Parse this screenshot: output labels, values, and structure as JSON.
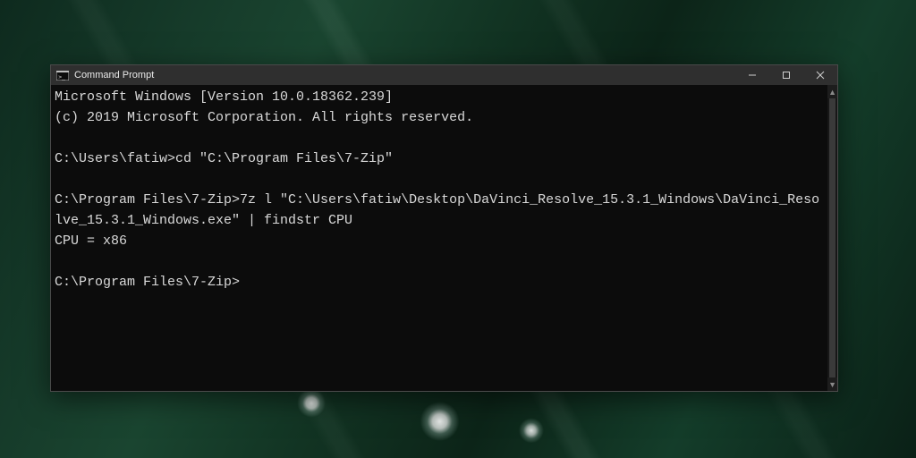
{
  "window": {
    "title": "Command Prompt"
  },
  "terminal": {
    "lines": [
      "Microsoft Windows [Version 10.0.18362.239]",
      "(c) 2019 Microsoft Corporation. All rights reserved.",
      "",
      "C:\\Users\\fatiw>cd \"C:\\Program Files\\7-Zip\"",
      "",
      "C:\\Program Files\\7-Zip>7z l \"C:\\Users\\fatiw\\Desktop\\DaVinci_Resolve_15.3.1_Windows\\DaVinci_Resolve_15.3.1_Windows.exe\" | findstr CPU",
      "CPU = x86",
      "",
      "C:\\Program Files\\7-Zip>"
    ]
  },
  "icons": {
    "cmd": "cmd-icon",
    "minimize": "minimize-icon",
    "maximize": "maximize-icon",
    "close": "close-icon",
    "scroll_up": "▲",
    "scroll_down": "▼"
  }
}
